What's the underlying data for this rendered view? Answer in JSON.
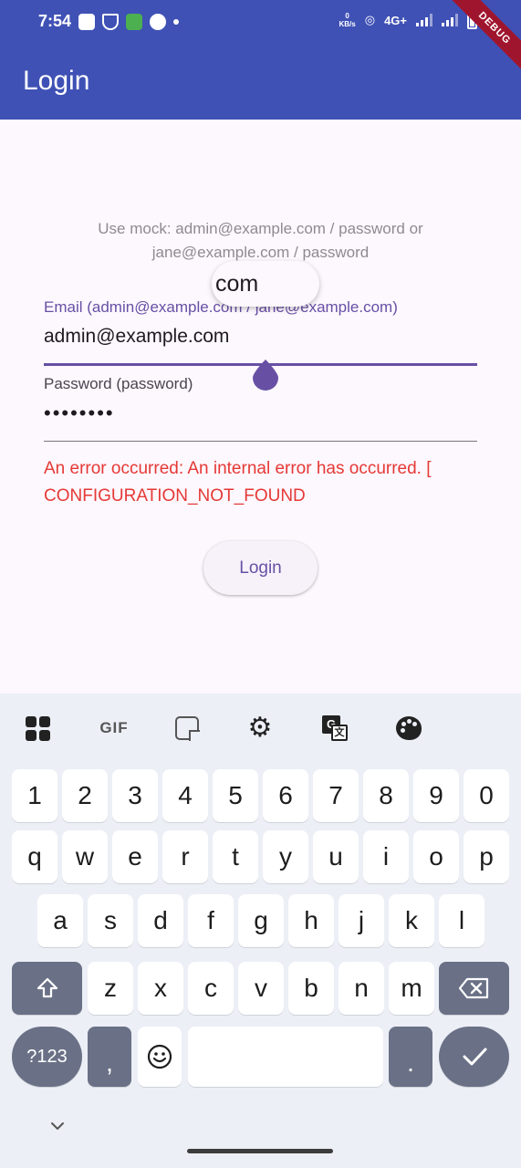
{
  "status_bar": {
    "time": "7:54",
    "net_speed_value": "0",
    "net_speed_unit": "KB/s",
    "network": "4G+"
  },
  "debug_banner": "DEBUG",
  "app_bar": {
    "title": "Login"
  },
  "login": {
    "hint": "Use mock: admin@example.com / password or jane@example.com / password",
    "magnifier_text": "com",
    "email_label": "Email (admin@example.com / jane@example.com)",
    "email_value": "admin@example.com",
    "password_label": "Password (password)",
    "password_value": "••••••••",
    "error": "An error occurred: An internal error has occurred. [ CONFIGURATION_NOT_FOUND",
    "login_button": "Login"
  },
  "keyboard": {
    "tools": {
      "gif": "GIF",
      "translate_a": "G",
      "translate_b": "文"
    },
    "row_numbers": [
      "1",
      "2",
      "3",
      "4",
      "5",
      "6",
      "7",
      "8",
      "9",
      "0"
    ],
    "row_q": [
      "q",
      "w",
      "e",
      "r",
      "t",
      "y",
      "u",
      "i",
      "o",
      "p"
    ],
    "row_a": [
      "a",
      "s",
      "d",
      "f",
      "g",
      "h",
      "j",
      "k",
      "l"
    ],
    "row_z": [
      "z",
      "x",
      "c",
      "v",
      "b",
      "n",
      "m"
    ],
    "symbols_key": "?123",
    "comma_key": ",",
    "period_key": "."
  },
  "colors": {
    "app_bar": "#3f51b5",
    "accent": "#6750a4",
    "error": "#e53935",
    "background": "#fdf7fe",
    "keyboard_bg": "#eceff6"
  }
}
